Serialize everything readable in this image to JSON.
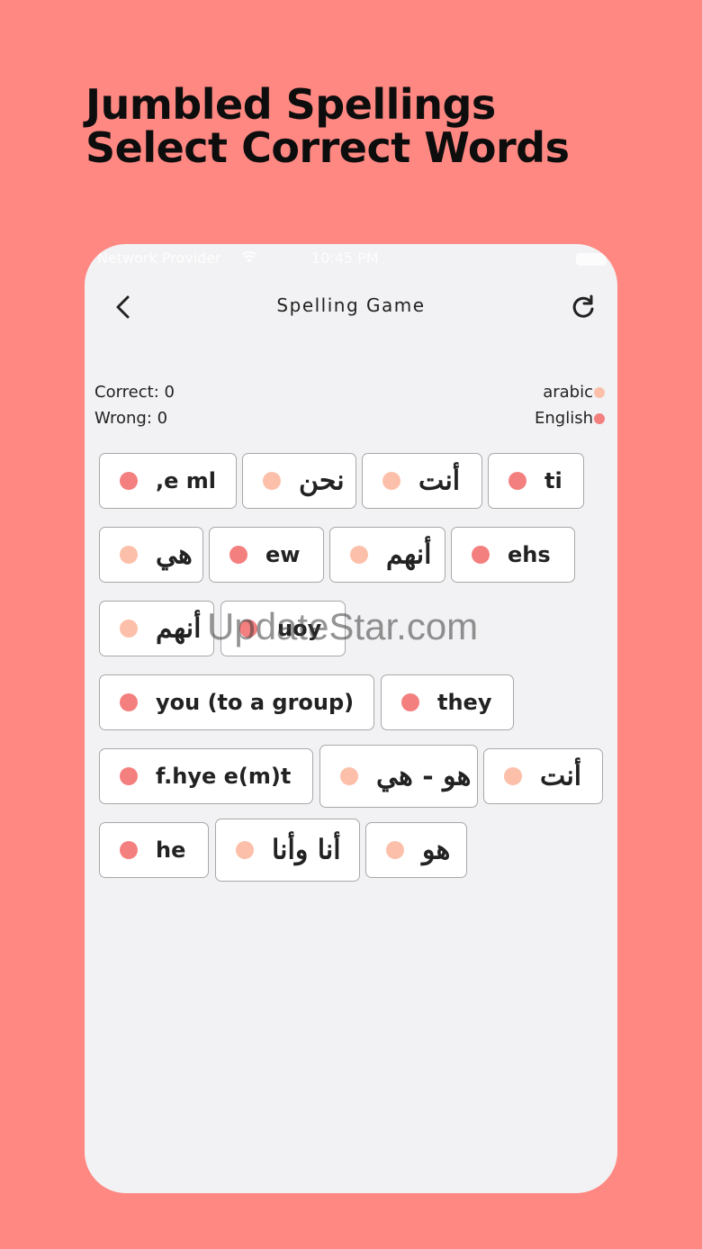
{
  "headline": {
    "line1": "Jumbled Spellings",
    "line2": "Select Correct Words"
  },
  "status_bar": {
    "carrier": "Network Provider",
    "time": "10:45 PM"
  },
  "nav": {
    "title": "Spelling Game",
    "back_icon": "chevron-left-icon",
    "refresh_icon": "refresh-icon"
  },
  "score": {
    "correct": "Correct: 0",
    "wrong": "Wrong: 0"
  },
  "legend": {
    "arabic": {
      "label": "arabic",
      "color": "#fcc0aa"
    },
    "english": {
      "label": "English",
      "color": "#f47f7f"
    }
  },
  "chips": [
    {
      "text": ",e ml",
      "lang": "english"
    },
    {
      "text": "نحن",
      "lang": "arabic"
    },
    {
      "text": "أنت",
      "lang": "arabic"
    },
    {
      "text": "ti",
      "lang": "english"
    },
    {
      "text": "هي",
      "lang": "arabic"
    },
    {
      "text": "ew",
      "lang": "english"
    },
    {
      "text": "أنهم",
      "lang": "arabic"
    },
    {
      "text": "ehs",
      "lang": "english"
    },
    {
      "text": "أنهم",
      "lang": "arabic"
    },
    {
      "text": "uoy",
      "lang": "english"
    },
    {
      "text": "you (to a group)",
      "lang": "english"
    },
    {
      "text": "they",
      "lang": "english"
    },
    {
      "text": "f.hye e(m)t",
      "lang": "english"
    },
    {
      "text": "هو - هي",
      "lang": "arabic"
    },
    {
      "text": "أنت",
      "lang": "arabic"
    },
    {
      "text": "he",
      "lang": "english"
    },
    {
      "text": "أنا وأنا",
      "lang": "arabic"
    },
    {
      "text": "هو",
      "lang": "arabic"
    }
  ],
  "watermark": "UpdateStar.com"
}
